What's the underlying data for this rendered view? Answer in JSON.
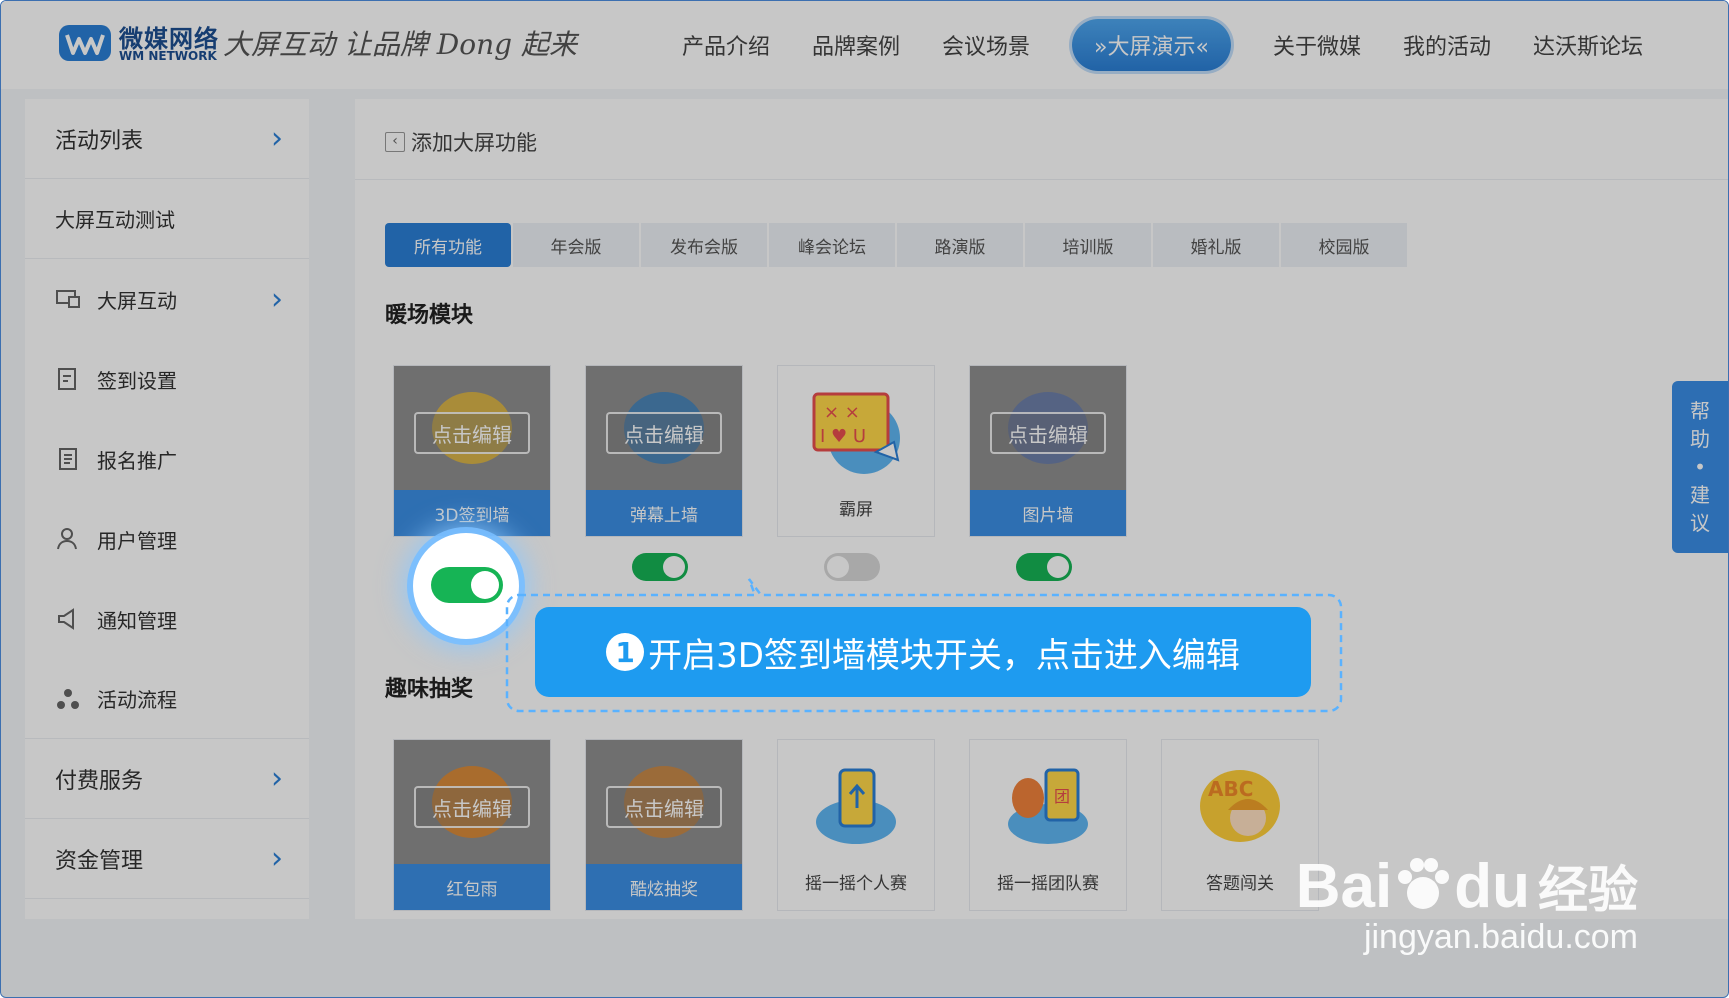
{
  "header": {
    "logo_cn": "微媒网络",
    "logo_en": "WM NETWORK",
    "slogan": "大屏互动 让品牌 Dong 起来",
    "nav": [
      {
        "label": "产品介绍"
      },
      {
        "label": "品牌案例"
      },
      {
        "label": "会议场景"
      },
      {
        "label": "»大屏演示«",
        "active": true
      },
      {
        "label": "关于微媒"
      },
      {
        "label": "我的活动"
      },
      {
        "label": "达沃斯论坛"
      }
    ]
  },
  "sidebar": {
    "items": [
      {
        "label": "活动列表",
        "arrow": "›"
      },
      {
        "label": "大屏互动测试"
      },
      {
        "label": "大屏互动",
        "icon": "screen-icon",
        "arrow": "›"
      },
      {
        "label": "签到设置",
        "icon": "checkin-icon"
      },
      {
        "label": "报名推广",
        "icon": "form-icon"
      },
      {
        "label": "用户管理",
        "icon": "user-icon"
      },
      {
        "label": "通知管理",
        "icon": "megaphone-icon"
      },
      {
        "label": "活动流程",
        "icon": "flow-icon"
      },
      {
        "label": "付费服务",
        "arrow": "›"
      },
      {
        "label": "资金管理",
        "arrow": "›"
      }
    ]
  },
  "main": {
    "back_label": "添加大屏功能",
    "tabs": [
      "所有功能",
      "年会版",
      "发布会版",
      "峰会论坛",
      "路演版",
      "培训版",
      "婚礼版",
      "校园版"
    ],
    "section1_title": "暖场模块",
    "section2_title": "趣味抽奖",
    "edit_label": "点击编辑",
    "section1_cards": [
      {
        "label": "3D签到墙",
        "enabled": true,
        "editable": true
      },
      {
        "label": "弹幕上墙",
        "enabled": true,
        "editable": true
      },
      {
        "label": "霸屏",
        "enabled": false,
        "editable": false
      },
      {
        "label": "图片墙",
        "enabled": true,
        "editable": true
      }
    ],
    "section2_cards": [
      {
        "label": "红包雨",
        "editable": true
      },
      {
        "label": "酷炫抽奖",
        "editable": true
      },
      {
        "label": "摇一摇个人赛",
        "editable": false
      },
      {
        "label": "摇一摇团队赛",
        "editable": false
      },
      {
        "label": "答题闯关",
        "editable": false
      }
    ]
  },
  "help": {
    "line1": "帮",
    "line2": "助",
    "dot": "•",
    "line3": "建",
    "line4": "议"
  },
  "callout": {
    "step": "1",
    "text": "开启3D签到墙模块开关，点击进入编辑"
  },
  "watermark": {
    "brand": "Bai",
    "brand2": "du",
    "cn": "经验",
    "url": "jingyan.baidu.com"
  },
  "colors": {
    "accent": "#2b7fd6",
    "toggle_on": "#16b455",
    "callout": "#1e9bf0"
  }
}
